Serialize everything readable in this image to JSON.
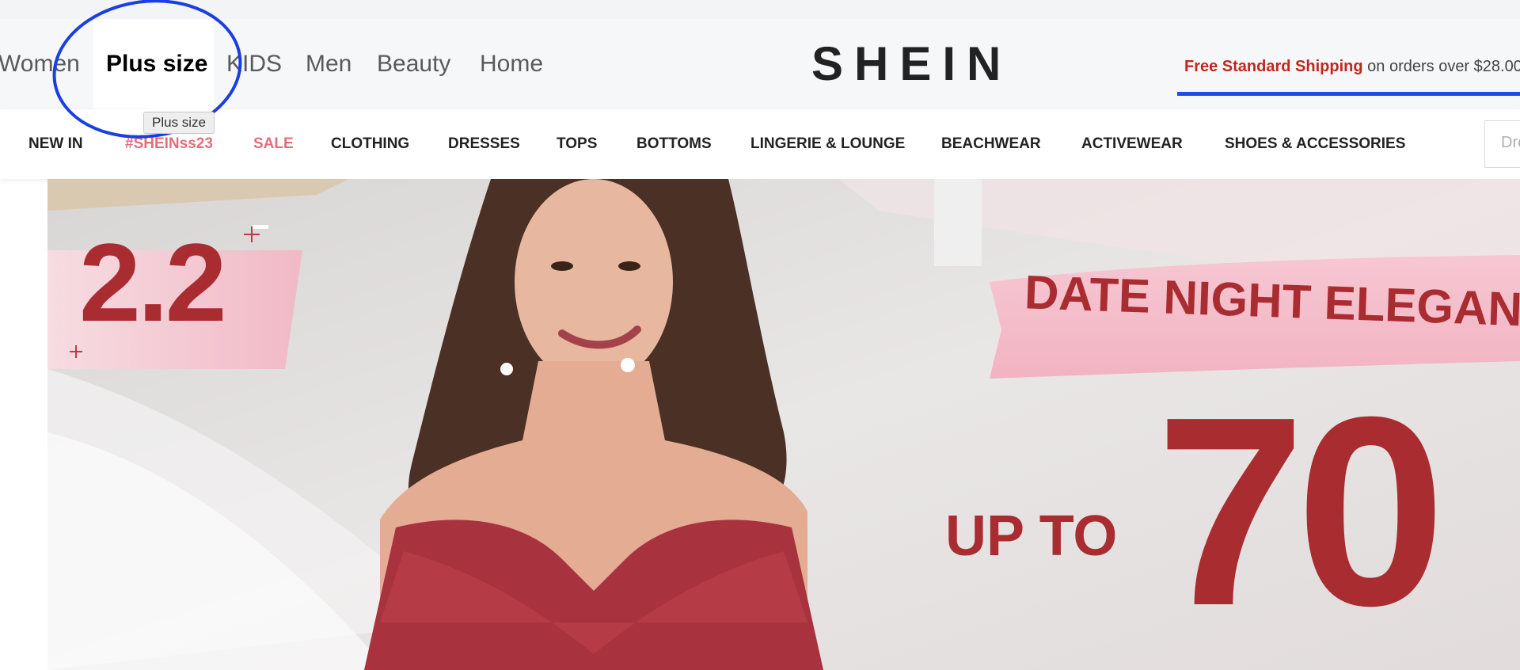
{
  "header": {
    "categories": [
      "Women",
      "Plus size",
      "KIDS",
      "Men",
      "Beauty",
      "Home"
    ],
    "active_category": "Plus size",
    "logo": "SHEIN",
    "shipping_highlight": "Free Standard Shipping",
    "shipping_rest": "on orders over $28.00",
    "tooltip": "Plus size"
  },
  "nav": {
    "items": [
      "NEW IN",
      "#SHEINss23",
      "SALE",
      "CLOTHING",
      "DRESSES",
      "TOPS",
      "BOTTOMS",
      "LINGERIE & LOUNGE",
      "BEACHWEAR",
      "ACTIVEWEAR",
      "SHOES & ACCESSORIES"
    ],
    "highlighted_items": [
      "#SHEINss23",
      "SALE"
    ],
    "search_placeholder": "Dre"
  },
  "banner": {
    "event": "2.2",
    "headline": "DATE NIGHT ELEGANC",
    "up_to": "UP TO",
    "percent": "70"
  },
  "colors": {
    "accent_red": "#a92c31",
    "sale_pink": "#e56d7a",
    "underline_blue": "#1f4ee4",
    "annotation_circle": "#1a3fe0"
  }
}
